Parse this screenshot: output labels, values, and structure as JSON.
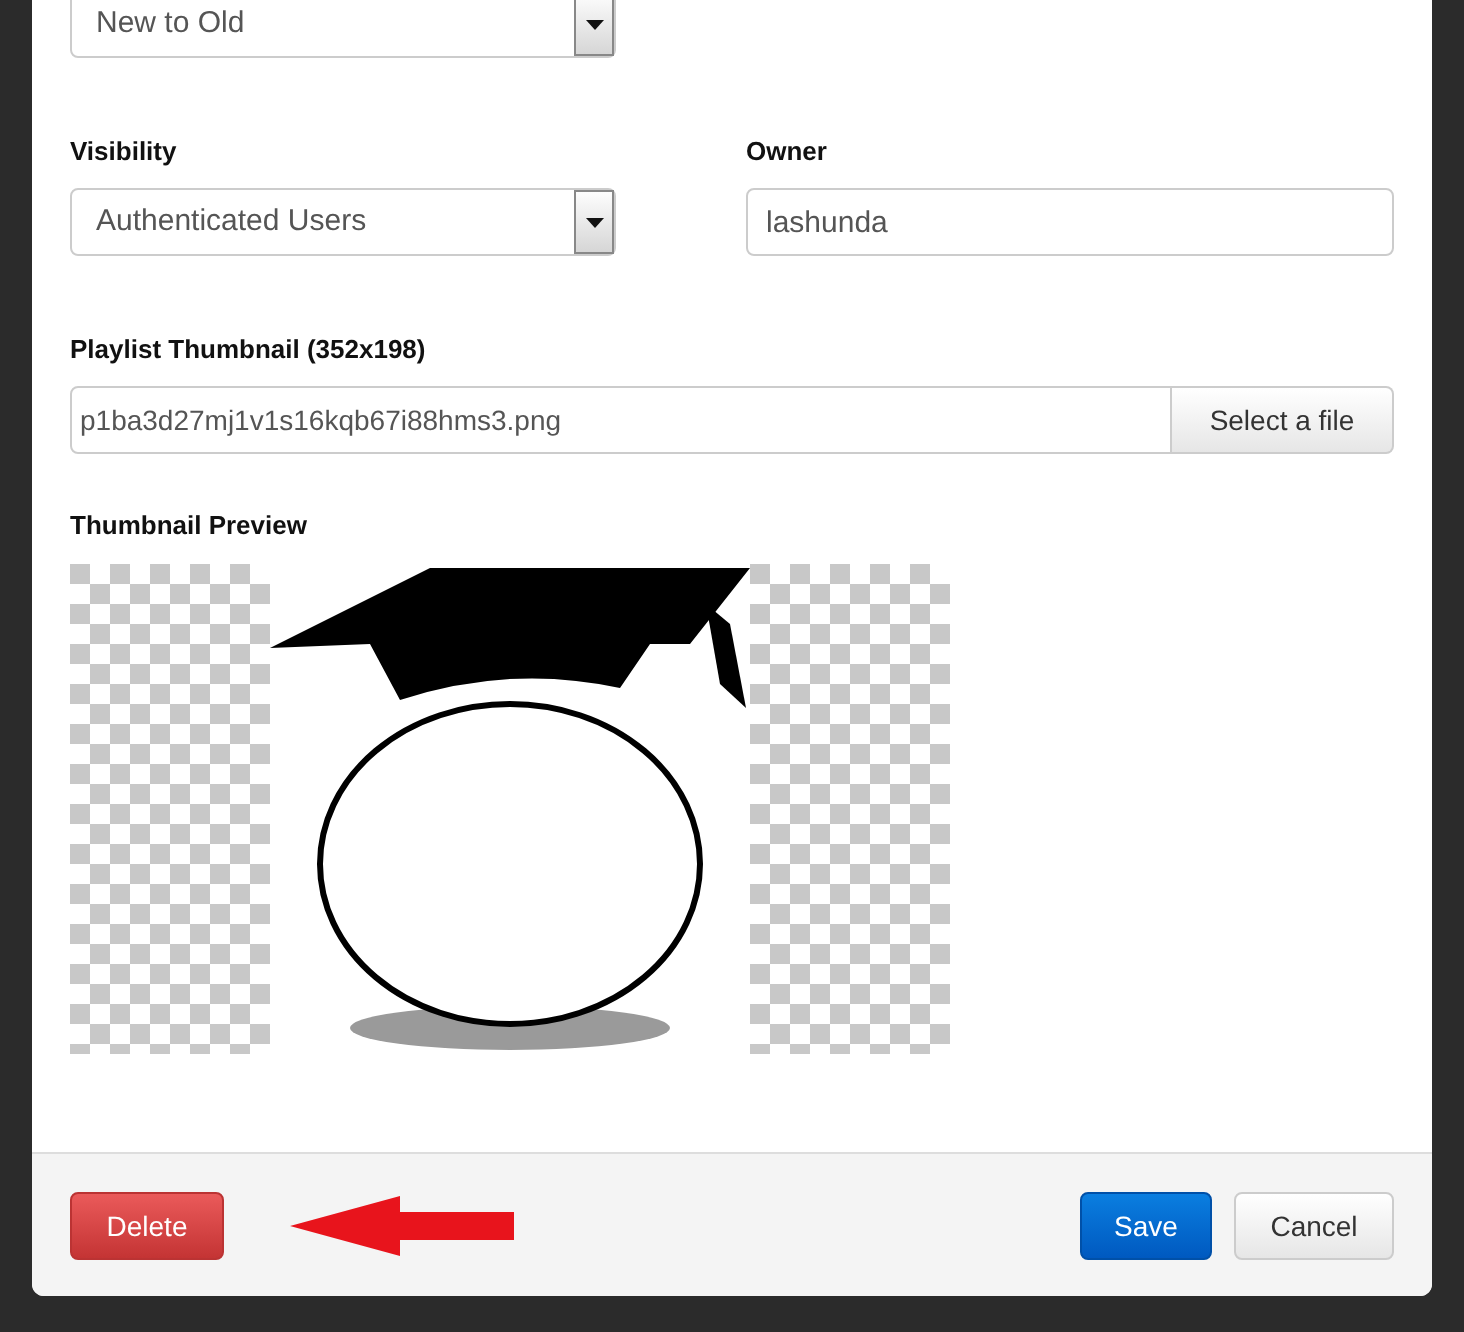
{
  "sort_select": {
    "value": "New to Old"
  },
  "visibility": {
    "label": "Visibility",
    "value": "Authenticated Users"
  },
  "owner": {
    "label": "Owner",
    "value": "lashunda"
  },
  "thumbnail": {
    "label": "Playlist Thumbnail (352x198)",
    "value": "p1ba3d27mj1v1s16kqb67i88hms3.png",
    "button": "Select a file"
  },
  "preview": {
    "label": "Thumbnail Preview"
  },
  "footer": {
    "buttons": [
      {
        "label": "Delete",
        "kind": "danger"
      },
      {
        "label": "Save",
        "kind": "primary"
      },
      {
        "label": "Cancel",
        "kind": "default"
      }
    ]
  }
}
